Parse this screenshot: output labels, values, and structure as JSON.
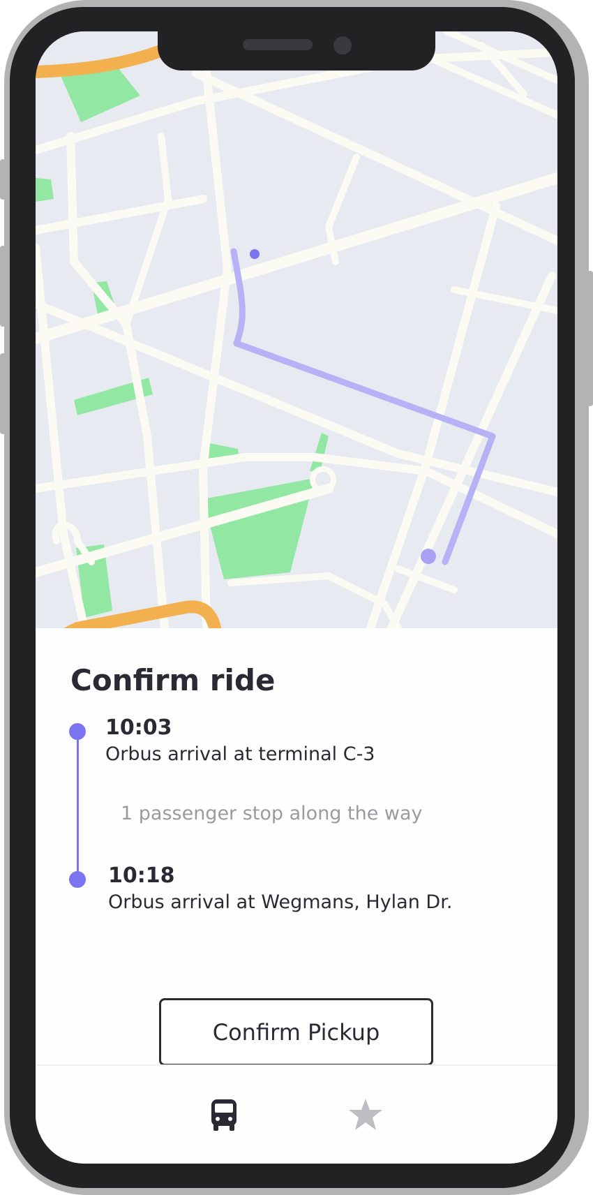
{
  "ride": {
    "title": "Confirm ride",
    "start": {
      "time": "10:03",
      "description": "Orbus arrival at terminal C-3"
    },
    "intermediate_note": "1 passenger stop along the way",
    "end": {
      "time": "10:18",
      "description": "Orbus arrival at Wegmans, Hylan Dr."
    },
    "confirm_label": "Confirm Pickup"
  },
  "tabbar": {
    "items": [
      {
        "icon": "bus-icon",
        "active": true
      },
      {
        "icon": "star-icon",
        "active": false
      }
    ]
  },
  "colors": {
    "accent": "#7b73f0",
    "route": "#b6b2f6",
    "map_bg": "#e8eaf2",
    "road": "#fbfbf3",
    "park": "#92e8a2",
    "highway": "#f3b04e",
    "text": "#2a2a35",
    "muted": "#9a9aa0"
  }
}
